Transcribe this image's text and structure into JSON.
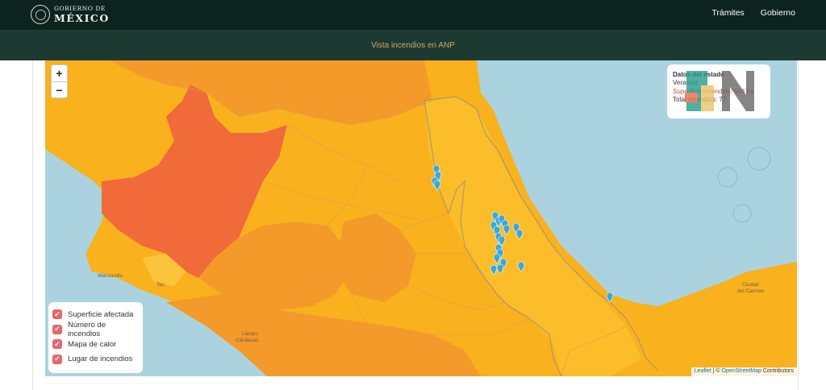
{
  "header": {
    "logo_line1": "GOBIERNO DE",
    "logo_line2": "MÉXICO",
    "nav": [
      "Trámites",
      "Gobierno"
    ]
  },
  "subheader": {
    "title": "Vista incendios en ANP"
  },
  "map": {
    "zoom_in": "+",
    "zoom_out": "−",
    "labels": {
      "manzanillo": "Manzanillo",
      "tecoman": "Tec",
      "lazaro": "Lázaro",
      "cardenas": "Cárdenas",
      "ciudad": "Ciudad",
      "del_carmen": "del Carmen"
    },
    "colors": {
      "sea": "#aad3df",
      "land": "#f9b11e",
      "orange": "#f49a2a",
      "red": "#f06a3a",
      "yellow_light": "#fbc43a",
      "marker": "#3aa8d8"
    }
  },
  "info_panel": {
    "title": "Datos del estado",
    "state": "Veracruz",
    "surface_label": "Superficie incendios: 564 ha",
    "total_label": "Total incendios: 77"
  },
  "legend": {
    "items": [
      {
        "label": "Superficie afectada",
        "checked": true
      },
      {
        "label": "Número de incendios",
        "checked": true
      },
      {
        "label": "Mapa de calor",
        "checked": true
      },
      {
        "label": "Lugar de incendios",
        "checked": true
      }
    ]
  },
  "attribution": {
    "leaflet": "Leaflet",
    "separator": " | © ",
    "osm": "OpenStreetMap",
    "contributors": " Contributors"
  }
}
